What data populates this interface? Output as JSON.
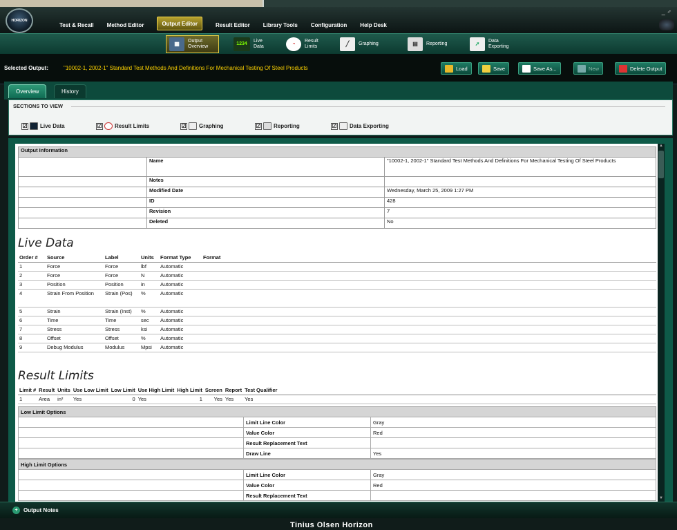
{
  "colors": {
    "accent": "#0e5a48",
    "selected_output": "#ffd400",
    "active_tab_border": "#f1d34a"
  },
  "titlebar": {
    "logo_text": "HORIZON",
    "menu": [
      {
        "label": "Test & Recall"
      },
      {
        "label": "Method Editor"
      },
      {
        "label": "Output Editor"
      },
      {
        "label": "Result Editor"
      },
      {
        "label": "Library Tools"
      },
      {
        "label": "Configuration"
      },
      {
        "label": "Help Desk"
      }
    ],
    "window_controls": "_ ♂"
  },
  "ribbon": {
    "buttons": [
      {
        "label": "Output Overview",
        "icon": "output-overview-icon"
      },
      {
        "label": "Live Data",
        "icon": "live-data-icon",
        "icon_text": "1234"
      },
      {
        "label": "Result Limits",
        "icon": "result-limits-icon"
      },
      {
        "label": "Graphing",
        "icon": "graphing-icon"
      },
      {
        "label": "Reporting",
        "icon": "reporting-icon"
      },
      {
        "label": "Data Exporting",
        "icon": "data-exporting-icon"
      }
    ]
  },
  "selected_output": {
    "label": "Selected Output:",
    "value": "\"10002-1, 2002-1\" Standard Test Methods And Definitions For Mechanical Testing Of Steel Products"
  },
  "toolbar": {
    "load": "Load",
    "save": "Save",
    "save_as": "Save As...",
    "new": "New",
    "delete": "Delete Output"
  },
  "tabs": {
    "overview": "Overview",
    "history": "History"
  },
  "sections": {
    "title": "SECTIONS TO VIEW",
    "items": [
      {
        "label": "Live Data",
        "checked": "☑"
      },
      {
        "label": "Result Limits",
        "checked": "☑"
      },
      {
        "label": "Graphing",
        "checked": "☑"
      },
      {
        "label": "Reporting",
        "checked": "☑"
      },
      {
        "label": "Data Exporting",
        "checked": "☑"
      }
    ]
  },
  "output_info": {
    "header": "Output Information",
    "rows": [
      {
        "key": "Name",
        "value": "\"10002-1, 2002-1\" Standard Test Methods And Definitions For Mechanical Testing Of Steel Products"
      },
      {
        "key": "Notes",
        "value": ""
      },
      {
        "key": "Modified Date",
        "value": "Wednesday, March 25, 2009 1:27 PM"
      },
      {
        "key": "ID",
        "value": "428"
      },
      {
        "key": "Revision",
        "value": "7"
      },
      {
        "key": "Deleted",
        "value": "No"
      }
    ]
  },
  "live_data": {
    "title": "Live Data",
    "columns": [
      "Order #",
      "Source",
      "Label",
      "Units",
      "Format Type",
      "Format"
    ],
    "rows": [
      [
        "1",
        "Force",
        "Force",
        "lbf",
        "Automatic",
        ""
      ],
      [
        "2",
        "Force",
        "Force",
        "N",
        "Automatic",
        ""
      ],
      [
        "3",
        "Position",
        "Position",
        "in",
        "Automatic",
        ""
      ],
      [
        "4",
        "Strain From Position",
        "Strain (Pos)",
        "%",
        "Automatic",
        ""
      ],
      [
        "5",
        "Strain",
        "Strain (Inst)",
        "%",
        "Automatic",
        ""
      ],
      [
        "6",
        "Time",
        "Time",
        "sec",
        "Automatic",
        ""
      ],
      [
        "7",
        "Stress",
        "Stress",
        "ksi",
        "Automatic",
        ""
      ],
      [
        "8",
        "Offset",
        "Offset",
        "%",
        "Automatic",
        ""
      ],
      [
        "9",
        "Debug Modulus",
        "Modulus",
        "Mpsi",
        "Automatic",
        ""
      ]
    ]
  },
  "result_limits": {
    "title": "Result Limits",
    "columns": [
      "Limit #",
      "Result",
      "Units",
      "Use Low Limit",
      "Low Limit",
      "Use High Limit",
      "High Limit",
      "Screen",
      "Report",
      "Test Qualifier"
    ],
    "rows": [
      [
        "1",
        "Area",
        "in²",
        "Yes",
        "0",
        "Yes",
        "1",
        "Yes",
        "Yes",
        "Yes"
      ]
    ],
    "low_options": {
      "header": "Low Limit Options",
      "rows": [
        {
          "key": "Limit Line Color",
          "value": "Gray"
        },
        {
          "key": "Value Color",
          "value": "Red"
        },
        {
          "key": "Result Replacement Text",
          "value": ""
        },
        {
          "key": "Draw Line",
          "value": "Yes"
        }
      ]
    },
    "high_options": {
      "header": "High Limit Options",
      "rows": [
        {
          "key": "Limit Line Color",
          "value": "Gray"
        },
        {
          "key": "Value Color",
          "value": "Red"
        },
        {
          "key": "Result Replacement Text",
          "value": ""
        }
      ]
    }
  },
  "bottom": {
    "notes_label": "Output Notes",
    "brand": "Tinius Olsen Horizon"
  }
}
